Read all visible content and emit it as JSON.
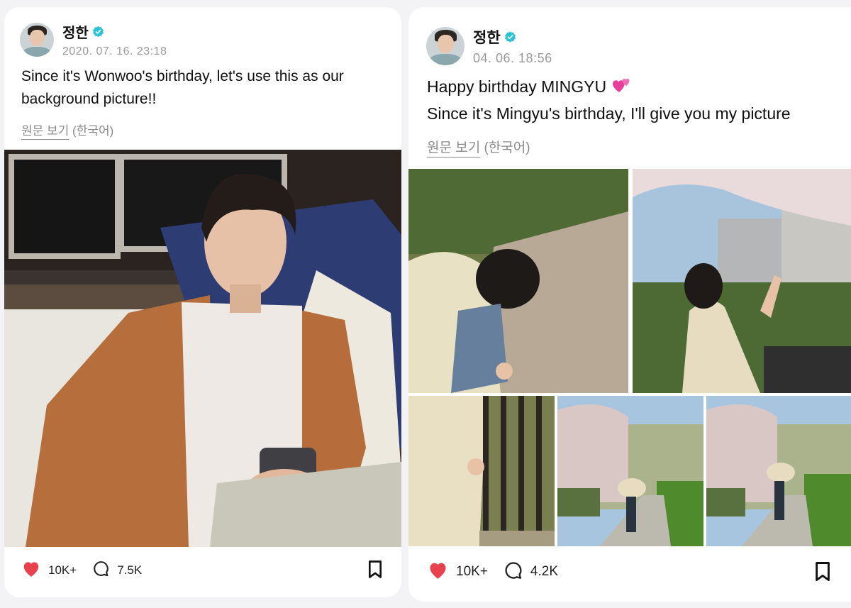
{
  "posts": [
    {
      "author": "정한",
      "timestamp": "2020. 07. 16. 23:18",
      "text_lines": [
        "Since it's Wonwoo's birthday, let's use this as our",
        "background picture!!"
      ],
      "view_original": "원문 보기",
      "language": "(한국어)",
      "likes": "10K+",
      "comments": "7.5K"
    },
    {
      "author": "정한",
      "timestamp": "04. 06. 18:56",
      "text_lines": [
        "Happy birthday MINGYU",
        "Since it's Mingyu's birthday, I'll give you my picture"
      ],
      "emoji": "💕",
      "view_original": "원문 보기",
      "language": "(한국어)",
      "likes": "10K+",
      "comments": "4.2K"
    }
  ],
  "colors": {
    "verified": "#2bc3d3",
    "like": "#e8424f",
    "meta_gray": "#9a9a9a"
  },
  "icons": [
    "verified-badge-icon",
    "heart-icon",
    "comment-icon",
    "bookmark-icon"
  ]
}
